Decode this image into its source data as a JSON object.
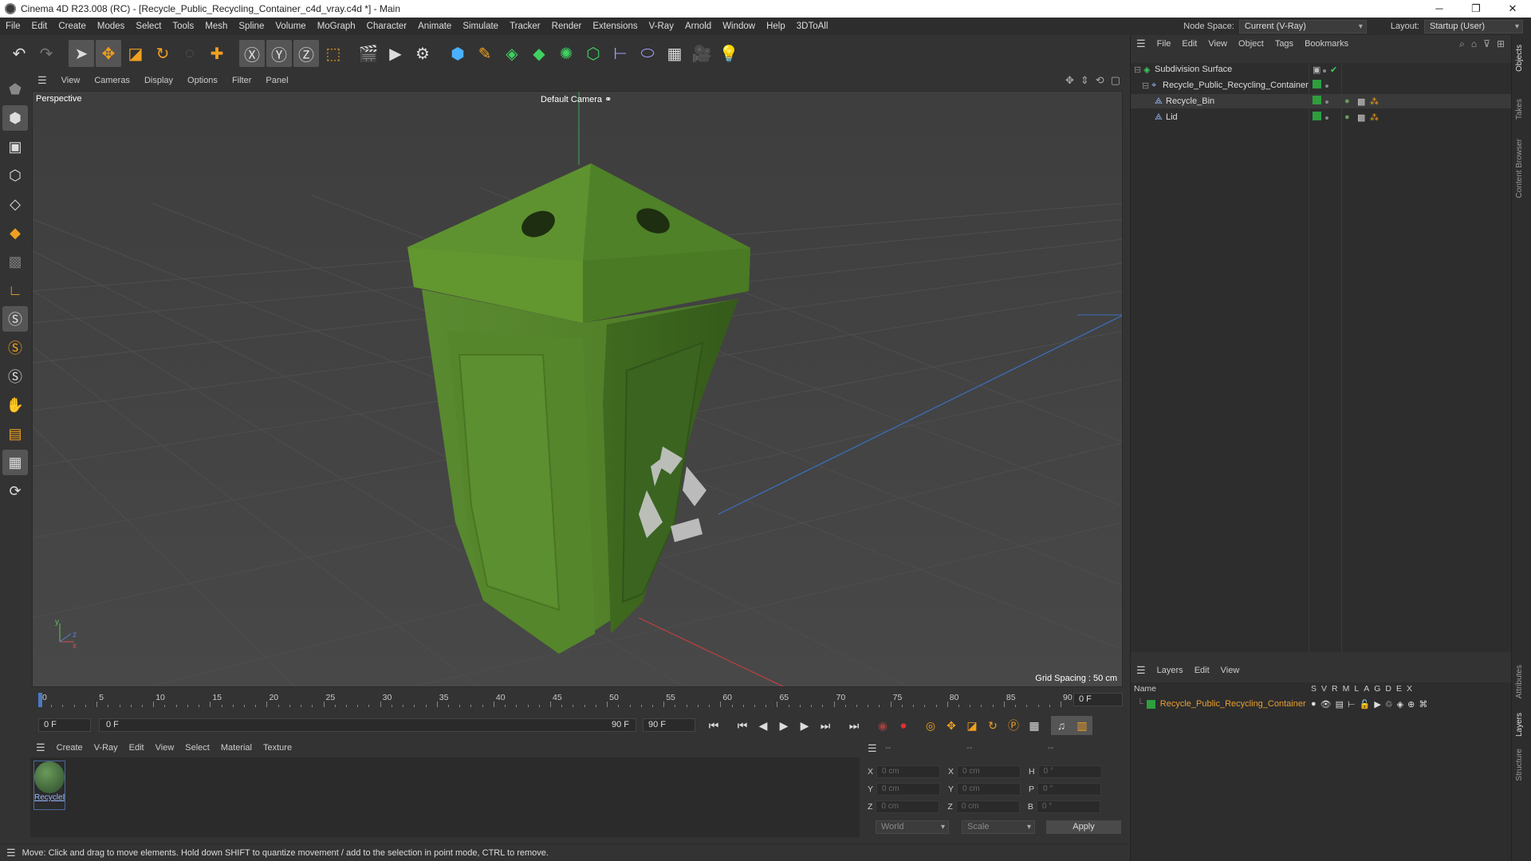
{
  "window": {
    "title": "Cinema 4D R23.008 (RC) - [Recycle_Public_Recycling_Container_c4d_vray.c4d *] - Main"
  },
  "menubar": {
    "items": [
      "File",
      "Edit",
      "Create",
      "Modes",
      "Select",
      "Tools",
      "Mesh",
      "Spline",
      "Volume",
      "MoGraph",
      "Character",
      "Animate",
      "Simulate",
      "Tracker",
      "Render",
      "Extensions",
      "V-Ray",
      "Arnold",
      "Window",
      "Help",
      "3DToAll"
    ],
    "node_space_label": "Node Space:",
    "node_space_value": "Current (V-Ray)",
    "layout_label": "Layout:",
    "layout_value": "Startup (User)"
  },
  "viewport": {
    "menu": [
      "View",
      "Cameras",
      "Display",
      "Options",
      "Filter",
      "Panel"
    ],
    "label": "Perspective",
    "camera": "Default Camera",
    "grid_spacing": "Grid Spacing : 50 cm",
    "axis_y": "y",
    "axis_z": "z",
    "axis_x": "x"
  },
  "timeline": {
    "ticks": [
      "0",
      "5",
      "10",
      "15",
      "20",
      "25",
      "30",
      "35",
      "40",
      "45",
      "50",
      "55",
      "60",
      "65",
      "70",
      "75",
      "80",
      "85",
      "90"
    ],
    "current": "0 F"
  },
  "playback": {
    "start": "0 F",
    "range_start": "0 F",
    "range_end": "90 F",
    "end": "90 F"
  },
  "material_manager": {
    "menu": [
      "Create",
      "V-Ray",
      "Edit",
      "View",
      "Select",
      "Material",
      "Texture"
    ],
    "material_name": "RecycleB"
  },
  "coords": {
    "headers": [
      "--",
      "--",
      "--"
    ],
    "rows": [
      {
        "a": "X",
        "av": "0 cm",
        "b": "X",
        "bv": "0 cm",
        "c": "H",
        "cv": "0 °"
      },
      {
        "a": "Y",
        "av": "0 cm",
        "b": "Y",
        "bv": "0 cm",
        "c": "P",
        "cv": "0 °"
      },
      {
        "a": "Z",
        "av": "0 cm",
        "b": "Z",
        "bv": "0 cm",
        "c": "B",
        "cv": "0 °"
      }
    ],
    "world": "World",
    "scale": "Scale",
    "apply": "Apply"
  },
  "status": "Move: Click and drag to move elements. Hold down SHIFT to quantize movement / add to the selection in point mode, CTRL to remove.",
  "object_manager": {
    "menu": [
      "File",
      "Edit",
      "View",
      "Object",
      "Tags",
      "Bookmarks"
    ],
    "objects": [
      "Subdivision Surface",
      "Recycle_Public_Recycling_Container",
      "Recycle_Bin",
      "Lid"
    ]
  },
  "layer_manager": {
    "menu": [
      "Layers",
      "Edit",
      "View"
    ],
    "name_header": "Name",
    "cols": [
      "S",
      "V",
      "R",
      "M",
      "L",
      "A",
      "G",
      "D",
      "E",
      "X"
    ],
    "layer_name": "Recycle_Public_Recycling_Container"
  },
  "right_tabs": [
    "Objects",
    "Takes",
    "Content Browser",
    "Attributes",
    "Layers",
    "Structure"
  ],
  "colors": {
    "accent_green": "#2e9e3e",
    "layer_orange": "#e8a030",
    "bin_green": "#4f7f2a"
  }
}
